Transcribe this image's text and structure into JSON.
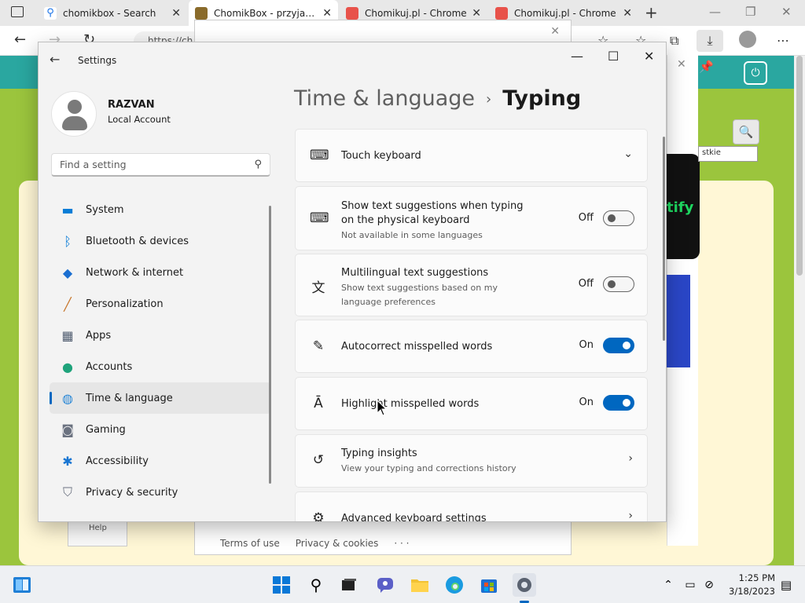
{
  "browser": {
    "tabs": [
      {
        "label": "chomikbox - Search",
        "close": "✕"
      },
      {
        "label": "ChomikBox - przyjazny",
        "close": "✕"
      },
      {
        "label": "Chomikuj.pl - Chrome",
        "close": "✕"
      },
      {
        "label": "Chomikuj.pl - Chrome",
        "close": "✕"
      }
    ],
    "new_tab": "+",
    "address": "https://ch",
    "window_controls": {
      "minimize": "—",
      "maximize": "❐",
      "close": "✕"
    }
  },
  "background_page": {
    "popup_footer": [
      "Terms of use",
      "Privacy & cookies",
      "· · ·"
    ],
    "popup_close": "✕",
    "panel_close": "✕",
    "help_label": "Help",
    "spotify_text": "tify",
    "select_text": "stkie",
    "search_glyph": "🔍"
  },
  "settings": {
    "title": "Settings",
    "back": "←",
    "controls": {
      "minimize": "—",
      "maximize": "☐",
      "close": "✕"
    },
    "account": {
      "name": "RAZVAN",
      "type": "Local Account"
    },
    "search_placeholder": "Find a setting",
    "nav": [
      {
        "label": "System",
        "icon": "system-icon",
        "glyph": "▬",
        "color": "#0a7cd6"
      },
      {
        "label": "Bluetooth & devices",
        "icon": "bluetooth-icon",
        "glyph": "ᛒ",
        "color": "#0a7cd6"
      },
      {
        "label": "Network & internet",
        "icon": "wifi-icon",
        "glyph": "◆",
        "color": "#1b6fd1"
      },
      {
        "label": "Personalization",
        "icon": "brush-icon",
        "glyph": "╱",
        "color": "#c7762b"
      },
      {
        "label": "Apps",
        "icon": "apps-icon",
        "glyph": "▦",
        "color": "#4e5b6e"
      },
      {
        "label": "Accounts",
        "icon": "accounts-icon",
        "glyph": "●",
        "color": "#1fa37b"
      },
      {
        "label": "Time & language",
        "icon": "globe-clock-icon",
        "glyph": "◍",
        "color": "#2a88d6"
      },
      {
        "label": "Gaming",
        "icon": "gamepad-icon",
        "glyph": "◙",
        "color": "#6b7280"
      },
      {
        "label": "Accessibility",
        "icon": "accessibility-icon",
        "glyph": "✱",
        "color": "#1976d2"
      },
      {
        "label": "Privacy & security",
        "icon": "shield-icon",
        "glyph": "⛉",
        "color": "#6b7280"
      }
    ],
    "selected_nav": "Time & language",
    "breadcrumb": {
      "parent": "Time & language",
      "separator": "›",
      "current": "Typing"
    },
    "cards": [
      {
        "title": "Touch keyboard",
        "icon": "keyboard-icon",
        "glyph": "⌨",
        "chevron": "⌄"
      },
      {
        "title": "Show text suggestions when typing on the physical keyboard",
        "subtitle": "Not available in some languages",
        "icon": "keyboard-filled-icon",
        "glyph": "⌨",
        "state": "Off",
        "on": false
      },
      {
        "title": "Multilingual text suggestions",
        "subtitle": "Show text suggestions based on my language preferences",
        "icon": "language-icon",
        "glyph": "文",
        "state": "Off",
        "on": false
      },
      {
        "title": "Autocorrect misspelled words",
        "icon": "autocorrect-icon",
        "glyph": "✎",
        "state": "On",
        "on": true
      },
      {
        "title": "Highlight misspelled words",
        "icon": "highlight-text-icon",
        "glyph": "Ā",
        "state": "On",
        "on": true
      },
      {
        "title": "Typing insights",
        "subtitle": "View your typing and corrections history",
        "icon": "history-icon",
        "glyph": "↺",
        "chevron": "›"
      },
      {
        "title": "Advanced keyboard settings",
        "icon": "gear-icon",
        "glyph": "⚙",
        "chevron": "›"
      }
    ]
  },
  "taskbar": {
    "time": "1:25 PM",
    "date": "3/18/2023",
    "tray_chevron": "⌃"
  }
}
